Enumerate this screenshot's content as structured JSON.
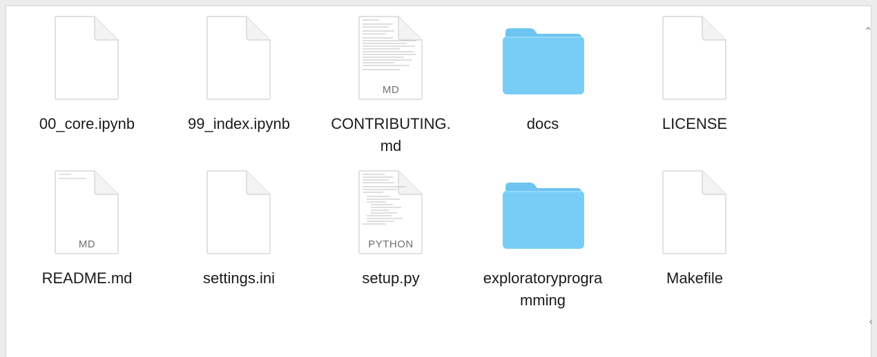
{
  "window": {
    "background": "#ffffff",
    "files": [
      {
        "name": "00_core.ipynb",
        "kind": "document",
        "icon": "blank-document-icon",
        "badge": ""
      },
      {
        "name": "99_index.ipynb",
        "kind": "document",
        "icon": "blank-document-icon",
        "badge": ""
      },
      {
        "name": "CONTRIBUTING.md",
        "display_lines": [
          "CONTRIBUTING.",
          "md"
        ],
        "kind": "document-preview",
        "icon": "markdown-document-icon",
        "badge": "MD"
      },
      {
        "name": "docs",
        "kind": "folder",
        "icon": "folder-icon",
        "badge": ""
      },
      {
        "name": "LICENSE",
        "kind": "document",
        "icon": "blank-document-icon",
        "badge": ""
      },
      {
        "name": "README.md",
        "kind": "document-preview",
        "icon": "markdown-document-icon",
        "badge": "MD"
      },
      {
        "name": "settings.ini",
        "kind": "document",
        "icon": "blank-document-icon",
        "badge": ""
      },
      {
        "name": "setup.py",
        "kind": "document-preview",
        "icon": "python-document-icon",
        "badge": "PYTHON"
      },
      {
        "name": "exploratoryprogramming",
        "display_lines": [
          "exploratoryprogra",
          "mming"
        ],
        "kind": "folder",
        "icon": "folder-icon",
        "badge": ""
      },
      {
        "name": "Makefile",
        "kind": "document",
        "icon": "blank-document-icon",
        "badge": ""
      }
    ]
  },
  "colors": {
    "folder_body": "#78cdf7",
    "folder_tab": "#6ec4f0",
    "document_fill": "#ffffff",
    "document_stroke": "#d7d7d7",
    "preview_text": "#b5b5b5"
  }
}
